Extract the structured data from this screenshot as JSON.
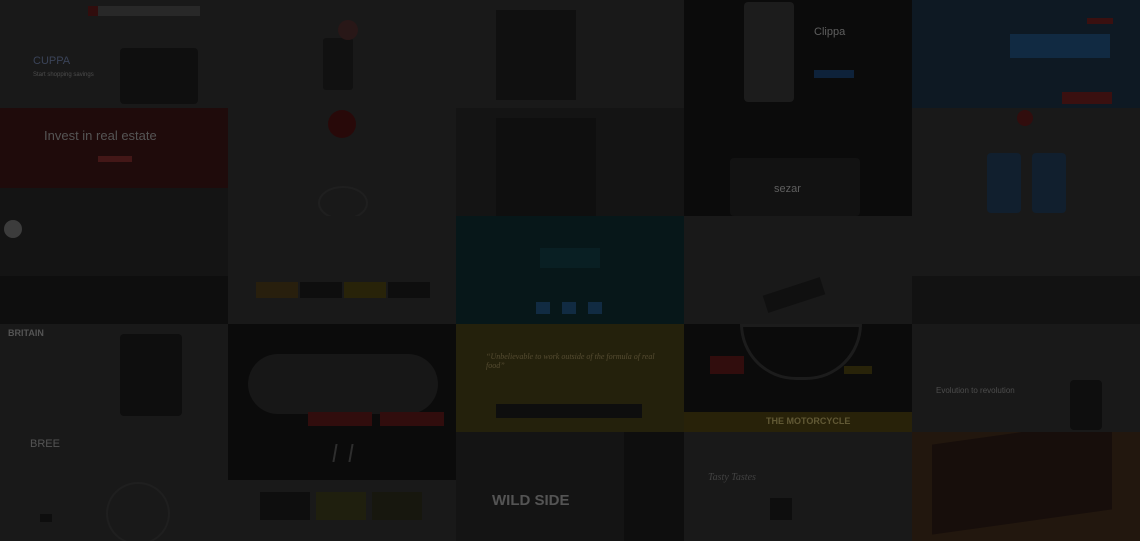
{
  "tiles": {
    "cuppa": {
      "logo": "CUPPA",
      "tagline": "Start shopping savings"
    },
    "invest": {
      "headline": "Invest in real estate"
    },
    "clippa_right": {
      "title": "Clippa"
    },
    "sezar": {
      "title": "sezar"
    },
    "bree": {
      "logo": "BREE"
    },
    "britain": {
      "logo": "BRITAIN"
    },
    "wild": {
      "title": "WILD SIDE"
    },
    "quote": {
      "text": "“Unbelievable to work outside of the formula of real food”"
    },
    "evolution": {
      "text": "Evolution to revolution"
    },
    "tasty": {
      "title": "Tasty Tastes"
    },
    "motorbike": {
      "title": "THE MOTORCYCLE"
    }
  }
}
